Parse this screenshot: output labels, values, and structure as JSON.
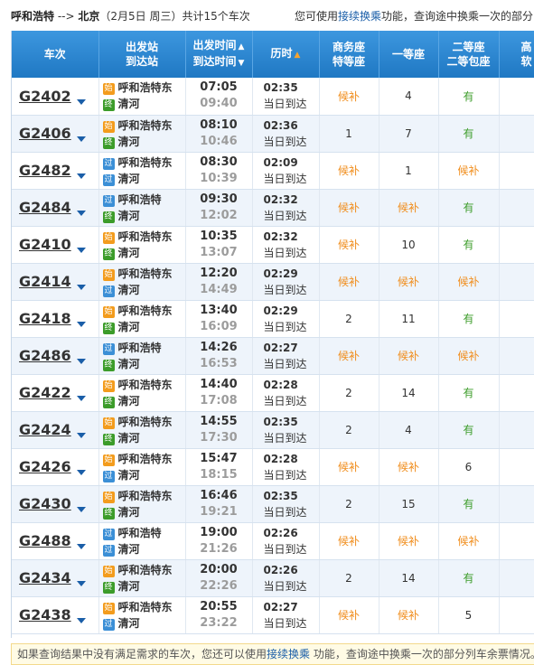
{
  "route": {
    "from": "呼和浩特",
    "arrow": "-->",
    "to": "北京",
    "date": "（2月5日  周三）",
    "count_prefix": "共计",
    "count": "15",
    "count_suffix": "个车次"
  },
  "tip": {
    "before": "您可使用",
    "link": "接续换乘",
    "after": "功能，查询途中换乘一次的部分"
  },
  "headers": {
    "train": "车次",
    "station_l1": "出发站",
    "station_l2": "到达站",
    "time_l1": "出发时间",
    "time_l2": "到达时间",
    "duration": "历时",
    "business_l1": "商务座",
    "business_l2": "特等座",
    "first": "一等座",
    "second_l1": "二等座",
    "second_l2": "二等包座",
    "next_l1": "高",
    "next_l2": "软"
  },
  "badges": {
    "start": "始",
    "pass": "过",
    "end": "终"
  },
  "rows": [
    {
      "train": "G2402",
      "dep_badge": "始",
      "dep_type": "start",
      "dep_station": "呼和浩特东",
      "arr_badge": "终",
      "arr_type": "end",
      "arr_station": "清河",
      "dep_time": "07:05",
      "arr_time": "09:40",
      "duration": "02:35",
      "note": "当日到达",
      "business": "候补",
      "first": "4",
      "second": "有"
    },
    {
      "train": "G2406",
      "dep_badge": "始",
      "dep_type": "start",
      "dep_station": "呼和浩特东",
      "arr_badge": "终",
      "arr_type": "end",
      "arr_station": "清河",
      "dep_time": "08:10",
      "arr_time": "10:46",
      "duration": "02:36",
      "note": "当日到达",
      "business": "1",
      "first": "7",
      "second": "有"
    },
    {
      "train": "G2482",
      "dep_badge": "过",
      "dep_type": "pass",
      "dep_station": "呼和浩特东",
      "arr_badge": "过",
      "arr_type": "pass",
      "arr_station": "清河",
      "dep_time": "08:30",
      "arr_time": "10:39",
      "duration": "02:09",
      "note": "当日到达",
      "business": "候补",
      "first": "1",
      "second": "候补"
    },
    {
      "train": "G2484",
      "dep_badge": "过",
      "dep_type": "pass",
      "dep_station": "呼和浩特",
      "arr_badge": "终",
      "arr_type": "end",
      "arr_station": "清河",
      "dep_time": "09:30",
      "arr_time": "12:02",
      "duration": "02:32",
      "note": "当日到达",
      "business": "候补",
      "first": "候补",
      "second": "有"
    },
    {
      "train": "G2410",
      "dep_badge": "始",
      "dep_type": "start",
      "dep_station": "呼和浩特东",
      "arr_badge": "终",
      "arr_type": "end",
      "arr_station": "清河",
      "dep_time": "10:35",
      "arr_time": "13:07",
      "duration": "02:32",
      "note": "当日到达",
      "business": "候补",
      "first": "10",
      "second": "有"
    },
    {
      "train": "G2414",
      "dep_badge": "始",
      "dep_type": "start",
      "dep_station": "呼和浩特东",
      "arr_badge": "过",
      "arr_type": "pass",
      "arr_station": "清河",
      "dep_time": "12:20",
      "arr_time": "14:49",
      "duration": "02:29",
      "note": "当日到达",
      "business": "候补",
      "first": "候补",
      "second": "候补"
    },
    {
      "train": "G2418",
      "dep_badge": "始",
      "dep_type": "start",
      "dep_station": "呼和浩特东",
      "arr_badge": "终",
      "arr_type": "end",
      "arr_station": "清河",
      "dep_time": "13:40",
      "arr_time": "16:09",
      "duration": "02:29",
      "note": "当日到达",
      "business": "2",
      "first": "11",
      "second": "有"
    },
    {
      "train": "G2486",
      "dep_badge": "过",
      "dep_type": "pass",
      "dep_station": "呼和浩特",
      "arr_badge": "终",
      "arr_type": "end",
      "arr_station": "清河",
      "dep_time": "14:26",
      "arr_time": "16:53",
      "duration": "02:27",
      "note": "当日到达",
      "business": "候补",
      "first": "候补",
      "second": "候补"
    },
    {
      "train": "G2422",
      "dep_badge": "始",
      "dep_type": "start",
      "dep_station": "呼和浩特东",
      "arr_badge": "终",
      "arr_type": "end",
      "arr_station": "清河",
      "dep_time": "14:40",
      "arr_time": "17:08",
      "duration": "02:28",
      "note": "当日到达",
      "business": "2",
      "first": "14",
      "second": "有"
    },
    {
      "train": "G2424",
      "dep_badge": "始",
      "dep_type": "start",
      "dep_station": "呼和浩特东",
      "arr_badge": "终",
      "arr_type": "end",
      "arr_station": "清河",
      "dep_time": "14:55",
      "arr_time": "17:30",
      "duration": "02:35",
      "note": "当日到达",
      "business": "2",
      "first": "4",
      "second": "有"
    },
    {
      "train": "G2426",
      "dep_badge": "始",
      "dep_type": "start",
      "dep_station": "呼和浩特东",
      "arr_badge": "过",
      "arr_type": "pass",
      "arr_station": "清河",
      "dep_time": "15:47",
      "arr_time": "18:15",
      "duration": "02:28",
      "note": "当日到达",
      "business": "候补",
      "first": "候补",
      "second": "6"
    },
    {
      "train": "G2430",
      "dep_badge": "始",
      "dep_type": "start",
      "dep_station": "呼和浩特东",
      "arr_badge": "终",
      "arr_type": "end",
      "arr_station": "清河",
      "dep_time": "16:46",
      "arr_time": "19:21",
      "duration": "02:35",
      "note": "当日到达",
      "business": "2",
      "first": "15",
      "second": "有"
    },
    {
      "train": "G2488",
      "dep_badge": "过",
      "dep_type": "pass",
      "dep_station": "呼和浩特",
      "arr_badge": "过",
      "arr_type": "pass",
      "arr_station": "清河",
      "dep_time": "19:00",
      "arr_time": "21:26",
      "duration": "02:26",
      "note": "当日到达",
      "business": "候补",
      "first": "候补",
      "second": "候补"
    },
    {
      "train": "G2434",
      "dep_badge": "始",
      "dep_type": "start",
      "dep_station": "呼和浩特东",
      "arr_badge": "终",
      "arr_type": "end",
      "arr_station": "清河",
      "dep_time": "20:00",
      "arr_time": "22:26",
      "duration": "02:26",
      "note": "当日到达",
      "business": "2",
      "first": "14",
      "second": "有"
    },
    {
      "train": "G2438",
      "dep_badge": "始",
      "dep_type": "start",
      "dep_station": "呼和浩特东",
      "arr_badge": "过",
      "arr_type": "pass",
      "arr_station": "清河",
      "dep_time": "20:55",
      "arr_time": "23:22",
      "duration": "02:27",
      "note": "当日到达",
      "business": "候补",
      "first": "候补",
      "second": "5"
    }
  ],
  "footer": {
    "before": "如果查询结果中没有满足需求的车次，您还可以使用",
    "link": "接续换乘",
    "after": " 功能，查询途中换乘一次的部分列车余票情况。"
  },
  "colors": {
    "header_blue": "#2b8ad6",
    "available_green": "#3c9c2a",
    "waitlist_orange": "#f08c1a",
    "badge_start": "#f39c1d",
    "badge_pass": "#3b8fd6",
    "badge_end": "#3c9c2a"
  }
}
